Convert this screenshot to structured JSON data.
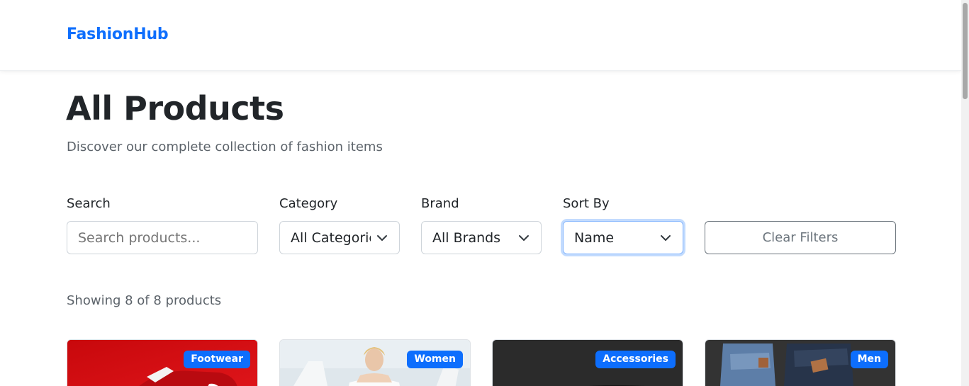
{
  "navbar": {
    "brand": "FashionHub"
  },
  "header": {
    "title": "All Products",
    "subtitle": "Discover our complete collection of fashion items"
  },
  "filters": {
    "search": {
      "label": "Search",
      "placeholder": "Search products..."
    },
    "category": {
      "label": "Category",
      "selected": "All Categories"
    },
    "brand": {
      "label": "Brand",
      "selected": "All Brands"
    },
    "sort": {
      "label": "Sort By",
      "selected": "Name"
    },
    "clear_label": "Clear Filters"
  },
  "results": {
    "count_text": "Showing 8 of 8 products"
  },
  "products": [
    {
      "badge": "Footwear"
    },
    {
      "badge": "Women"
    },
    {
      "badge": "Accessories"
    },
    {
      "badge": "Men"
    }
  ],
  "colors": {
    "accent": "#0d6efd",
    "muted_text": "#6c757d",
    "border": "#ced4da"
  },
  "icons": {
    "select_caret": "chevron-down-icon"
  }
}
